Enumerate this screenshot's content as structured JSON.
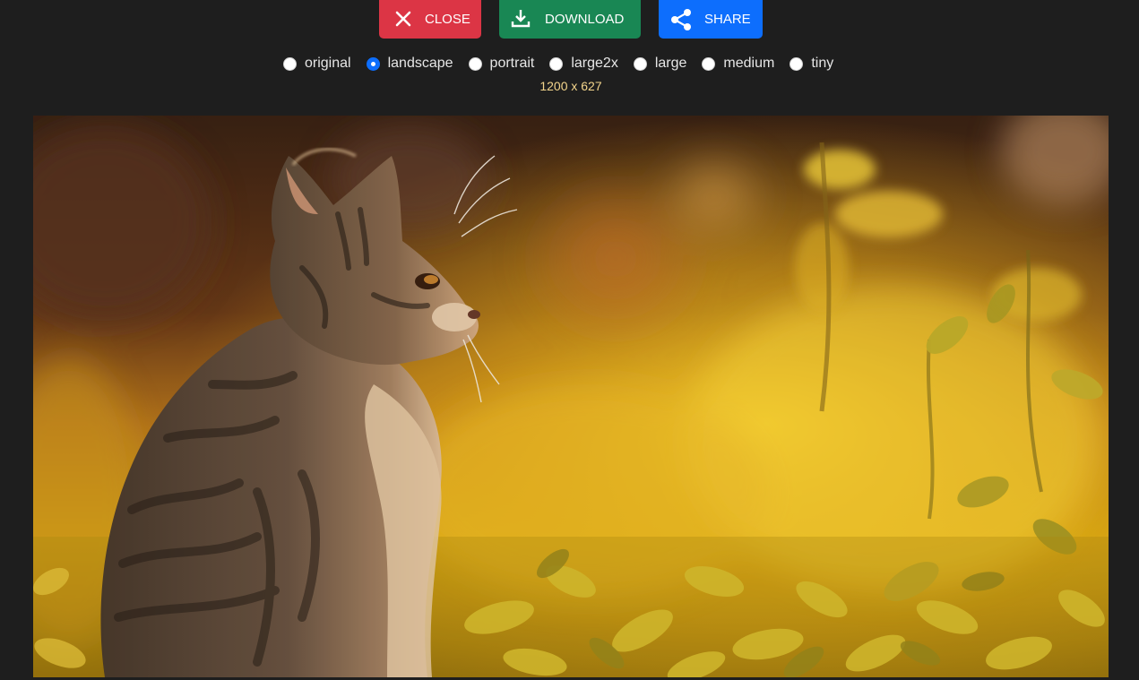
{
  "toolbar": {
    "close_label": "CLOSE",
    "download_label": "DOWNLOAD",
    "share_label": "SHARE",
    "close_icon": "close-icon",
    "download_icon": "download-icon",
    "share_icon": "share-icon",
    "colors": {
      "close": "#dc3545",
      "download": "#198754",
      "share": "#0d6efd"
    }
  },
  "sizes": {
    "options": [
      "original",
      "landscape",
      "portrait",
      "large2x",
      "large",
      "medium",
      "tiny"
    ],
    "selected": "landscape"
  },
  "dimensions": "1200 x 627",
  "image": {
    "subject": "tabby kitten sitting in yellow autumn grass"
  }
}
